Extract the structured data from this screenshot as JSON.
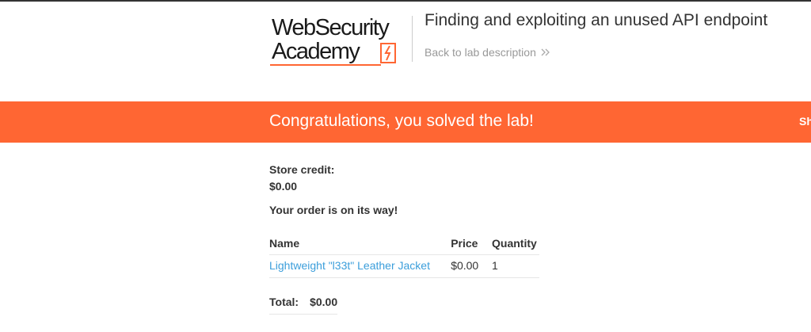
{
  "header": {
    "logo_line1": "WebSecurity",
    "logo_line2": "Academy",
    "logo_icon": "lightning-bolt-icon",
    "lab_title": "Finding and exploiting an unused API endpoint",
    "back_link": "Back to lab description"
  },
  "banner": {
    "message": "Congratulations, you solved the lab!",
    "partial_text": "Sh",
    "color": "#ff6633"
  },
  "account": {
    "credit_label": "Store credit:",
    "credit_value": "$0.00",
    "order_message": "Your order is on its way!"
  },
  "order_table": {
    "headers": [
      "Name",
      "Price",
      "Quantity"
    ],
    "rows": [
      {
        "name": "Lightweight \"l33t\" Leather Jacket",
        "price": "$0.00",
        "quantity": "1"
      }
    ]
  },
  "total": {
    "label": "Total:",
    "value": "$0.00"
  },
  "colors": {
    "accent": "#ff6633",
    "link": "#3b9edb",
    "text": "#333333"
  }
}
